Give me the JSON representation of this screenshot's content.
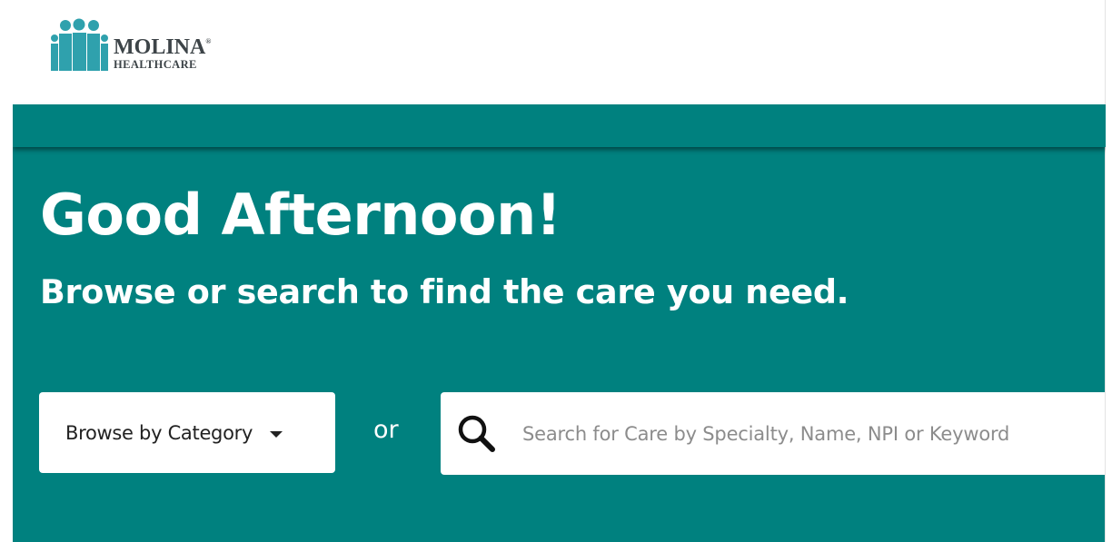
{
  "header": {
    "logo": {
      "brand_line1": "MOLINA",
      "brand_mark": "®",
      "brand_line2": "HEALTHCARE",
      "icon": "molina-people-logo-icon",
      "color": "#2fa1ad"
    }
  },
  "hero": {
    "greeting": "Good Afternoon!",
    "subtitle": "Browse or search to find the care you need.",
    "browse_button_label": "Browse by Category",
    "browse_caret_icon": "caret-down-icon",
    "or_text": "or",
    "search": {
      "icon": "search-icon",
      "placeholder": "Search for Care by Specialty, Name, NPI or Keyword",
      "value": ""
    }
  },
  "colors": {
    "brand_teal": "#00817f",
    "logo_teal": "#2fa1ad",
    "white": "#ffffff"
  }
}
